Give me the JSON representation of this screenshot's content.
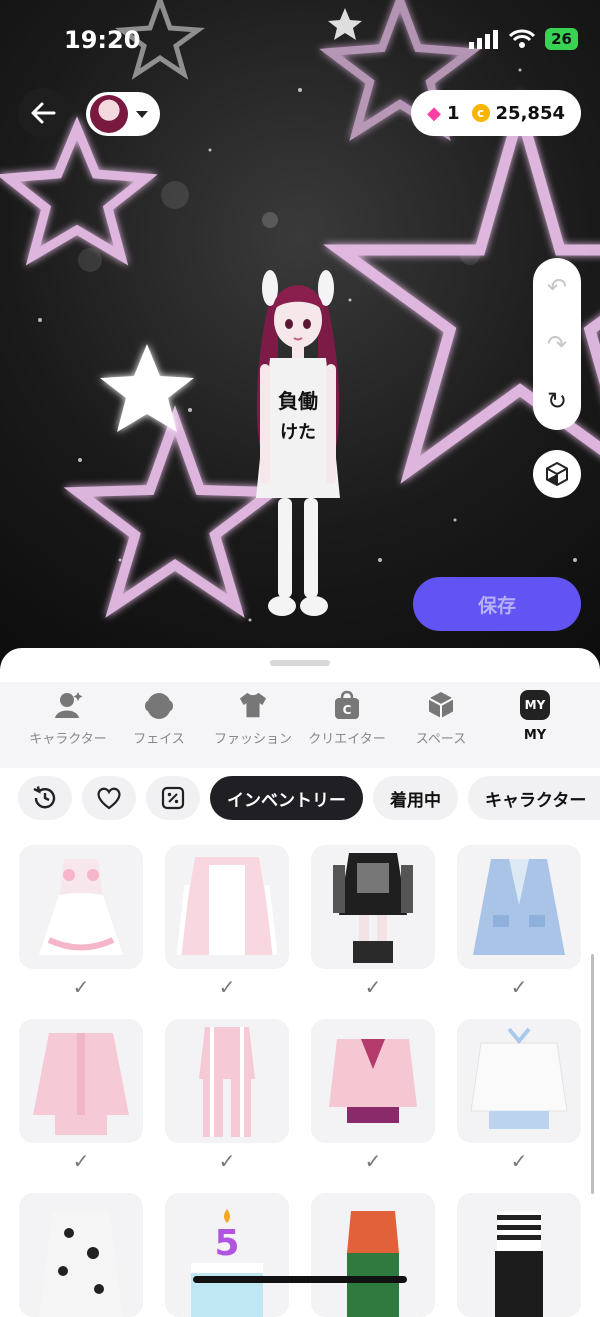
{
  "status_bar": {
    "time": "19:20",
    "battery": "26"
  },
  "currency": {
    "gems": "1",
    "coins": "25,854"
  },
  "save_label": "保存",
  "categories": [
    {
      "label": "キャラクター",
      "icon": "character-icon",
      "active": false
    },
    {
      "label": "フェイス",
      "icon": "face-icon",
      "active": false
    },
    {
      "label": "ファッション",
      "icon": "tshirt-icon",
      "active": false
    },
    {
      "label": "クリエイター",
      "icon": "creator-bag-icon",
      "active": false
    },
    {
      "label": "スペース",
      "icon": "space-cube-icon",
      "active": false
    },
    {
      "label": "MY",
      "icon_text": "MY",
      "icon": "my-badge-icon",
      "active": true
    }
  ],
  "filters": {
    "inventory": "インベントリー",
    "wearing": "着用中",
    "character": "キャラクター"
  },
  "items": [
    {
      "name": "pink-maid-outfit",
      "worn": true
    },
    {
      "name": "pink-white-track-jacket",
      "worn": true
    },
    {
      "name": "black-graphic-tshirt-outfit",
      "worn": true
    },
    {
      "name": "light-blue-cardigan-coat",
      "worn": true
    },
    {
      "name": "pink-track-jacket-set",
      "worn": true
    },
    {
      "name": "pink-tracksuit-pants",
      "worn": true
    },
    {
      "name": "pink-cardigan-plaid-skirt",
      "worn": true
    },
    {
      "name": "white-sweater-blue-skirt",
      "worn": true
    },
    {
      "name": "dalmatian-onesie",
      "worn": false
    },
    {
      "name": "birthday-cake-item",
      "worn": false
    },
    {
      "name": "orange-plaid-top-green-skirt",
      "worn": false
    },
    {
      "name": "striped-top-black-skirt",
      "worn": false
    }
  ],
  "colors": {
    "accent": "#6254f2",
    "dark_chip": "#1f1f24",
    "star_glow": "#f2c6f2"
  }
}
